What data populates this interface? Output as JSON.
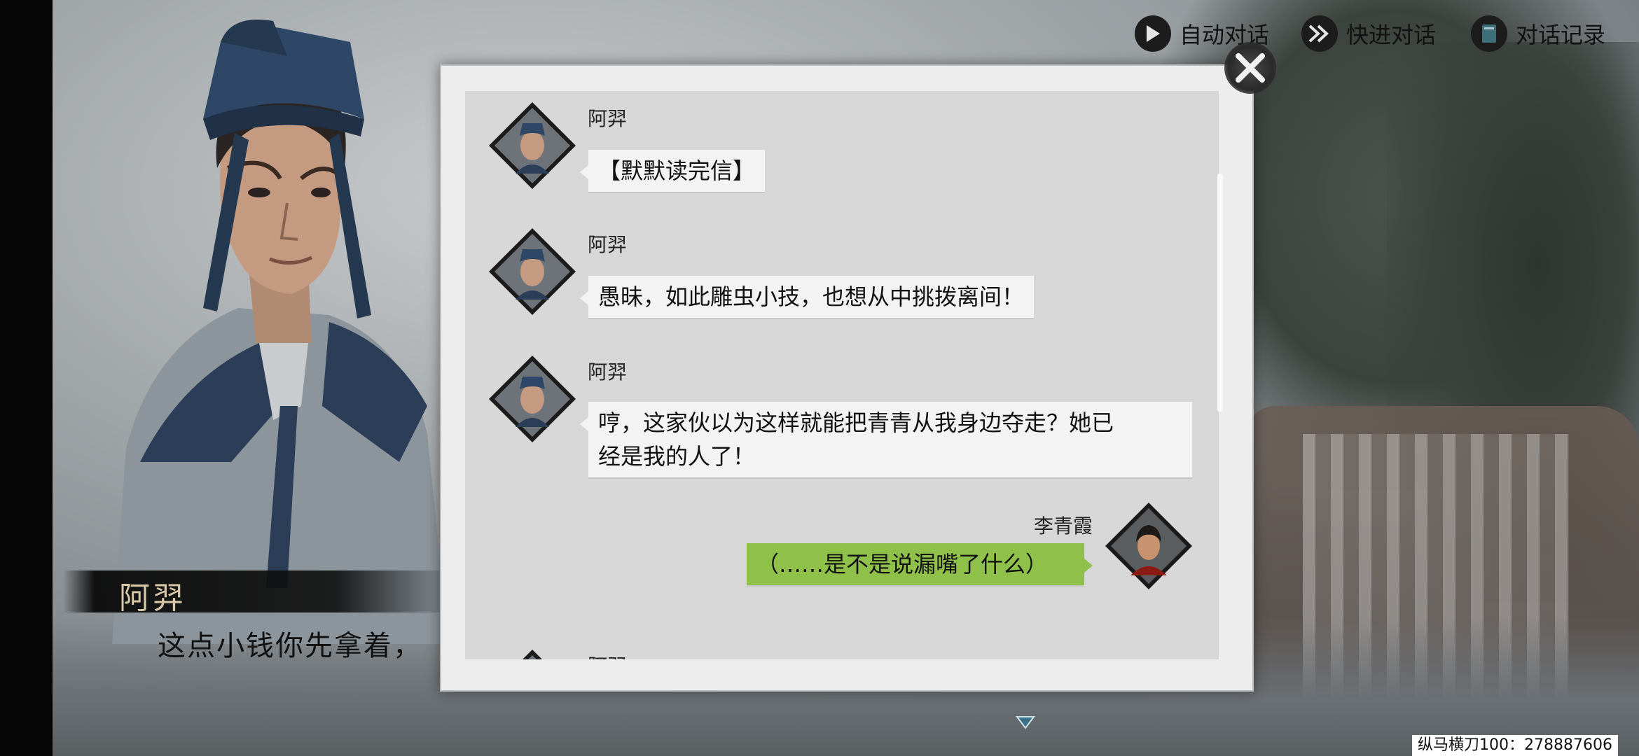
{
  "controls": {
    "auto": {
      "label": "自动对话",
      "icon": "play-icon"
    },
    "fast": {
      "label": "快进对话",
      "icon": "fast-forward-icon"
    },
    "log": {
      "label": "对话记录",
      "icon": "book-icon"
    }
  },
  "dialogue": {
    "speaker": "阿羿",
    "text": "这点小钱你先拿着，"
  },
  "log": {
    "messages": [
      {
        "speaker": "阿羿",
        "text": "【默默读完信】",
        "side": "left",
        "avatar": "ayi-portrait-icon"
      },
      {
        "speaker": "阿羿",
        "text": "愚昧，如此雕虫小技，也想从中挑拨离间！",
        "side": "left",
        "avatar": "ayi-portrait-icon"
      },
      {
        "speaker": "阿羿",
        "text_line1": "哼，这家伙以为这样就能把青青从我身边夺走？她已",
        "text_line2": "经是我的人了！",
        "side": "left",
        "avatar": "ayi-portrait-icon"
      },
      {
        "speaker": "李青霞",
        "text": "（……是不是说漏嘴了什么）",
        "side": "right",
        "avatar": "liqingxia-portrait-icon"
      },
      {
        "speaker": "阿羿",
        "side": "left",
        "avatar": "ayi-portrait-icon"
      }
    ]
  },
  "watermark": "纵马横刀100：278887606",
  "colors": {
    "player_bubble": "#8fc04a",
    "npc_bubble": "#f3f3f3",
    "name_gold": "#d9c9a6"
  }
}
